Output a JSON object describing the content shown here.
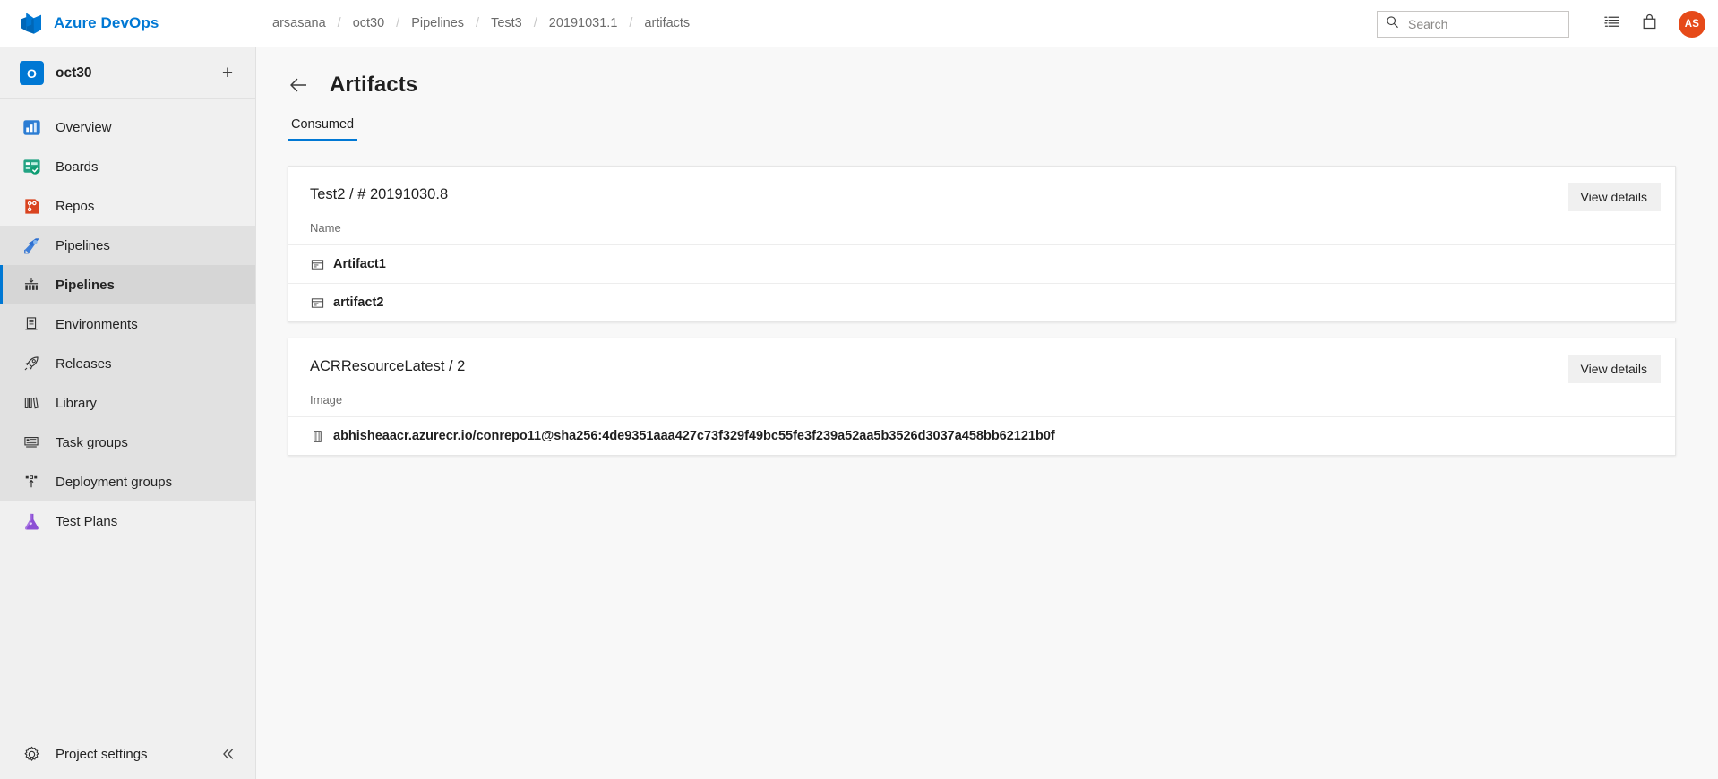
{
  "topbar": {
    "brand": "Azure DevOps",
    "brand_logo_icon": "azure-devops-logo",
    "breadcrumb": [
      "arsasana",
      "oct30",
      "Pipelines",
      "Test3",
      "20191031.1",
      "artifacts"
    ],
    "breadcrumb_separator": "/",
    "search": {
      "placeholder": "Search",
      "value": "",
      "icon": "search-icon"
    },
    "actions": [
      {
        "icon": "backlog-list-icon",
        "name": "work-items-button"
      },
      {
        "icon": "marketplace-bag-icon",
        "name": "marketplace-button"
      }
    ],
    "avatar": {
      "initials": "AS",
      "color": "#e64a19"
    }
  },
  "sidebar": {
    "project": {
      "name": "oct30",
      "icon_letter": "O",
      "color": "#0078d4"
    },
    "add_label": "+",
    "items": [
      {
        "label": "Overview",
        "icon": "overview-icon"
      },
      {
        "label": "Boards",
        "icon": "boards-icon"
      },
      {
        "label": "Repos",
        "icon": "repos-icon"
      },
      {
        "label": "Pipelines",
        "icon": "pipelines-icon"
      }
    ],
    "sub_items": [
      {
        "label": "Pipelines",
        "icon": "pipelines-sub-icon",
        "selected": true
      },
      {
        "label": "Environments",
        "icon": "environments-icon"
      },
      {
        "label": "Releases",
        "icon": "releases-rocket-icon"
      },
      {
        "label": "Library",
        "icon": "library-icon"
      },
      {
        "label": "Task groups",
        "icon": "task-groups-icon"
      },
      {
        "label": "Deployment groups",
        "icon": "deployment-groups-icon"
      }
    ],
    "tail_items": [
      {
        "label": "Test Plans",
        "icon": "test-plans-flask-icon"
      }
    ],
    "footer": {
      "label": "Project settings",
      "icon": "gear-icon"
    },
    "collapse_icon": "chevron-double-left-icon"
  },
  "page": {
    "title": "Artifacts",
    "back_icon": "back-arrow-icon",
    "tabs": [
      {
        "label": "Consumed",
        "active": true
      }
    ],
    "accent_color": "#0078d4"
  },
  "cards": [
    {
      "title": "Test2 / # 20191030.8",
      "action_label": "View details",
      "column_header": "Name",
      "rows": [
        {
          "label": "Artifact1",
          "icon": "artifact-package-icon"
        },
        {
          "label": "artifact2",
          "icon": "artifact-package-icon"
        }
      ]
    },
    {
      "title": "ACRResourceLatest / 2",
      "action_label": "View details",
      "column_header": "Image",
      "rows": [
        {
          "label": "abhisheaacr.azurecr.io/conrepo11@sha256:4de9351aaa427c73f329f49bc55fe3f239a52aa5b3526d3037a458bb62121b0f",
          "icon": "container-image-icon"
        }
      ]
    }
  ]
}
